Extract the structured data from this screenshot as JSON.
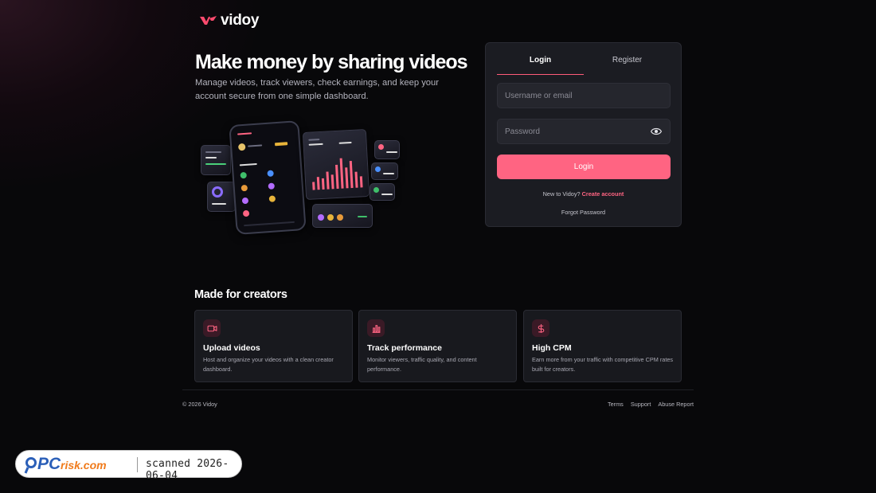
{
  "brand": {
    "name": "vidoy",
    "accent": "#ff6482"
  },
  "hero": {
    "title": "Make money by sharing videos",
    "subtitle": "Manage videos, track viewers, check earnings, and keep your account secure from one simple dashboard."
  },
  "auth": {
    "tabs": [
      {
        "label": "Login",
        "active": true
      },
      {
        "label": "Register",
        "active": false
      }
    ],
    "username_placeholder": "Username or email",
    "password_placeholder": "Password",
    "submit_label": "Login",
    "new_prompt": "New to Vidoy?",
    "create_link": "Create account",
    "forgot_link": "Forgot Password"
  },
  "features": {
    "title": "Made for creators",
    "items": [
      {
        "icon": "video-icon",
        "title": "Upload videos",
        "text": "Host and organize your videos with a clean creator dashboard."
      },
      {
        "icon": "bar-chart-icon",
        "title": "Track performance",
        "text": "Monitor viewers, traffic quality, and content performance."
      },
      {
        "icon": "dollar-icon",
        "title": "High CPM",
        "text": "Earn more from your traffic with competitive CPM rates built for creators."
      }
    ]
  },
  "footer": {
    "copyright": "© 2026 Vidoy",
    "links": [
      "Terms",
      "Support",
      "Abuse Report"
    ]
  },
  "watermark": {
    "logo_text": "PCrisk.com",
    "scan_text": "scanned 2026-06-04"
  }
}
